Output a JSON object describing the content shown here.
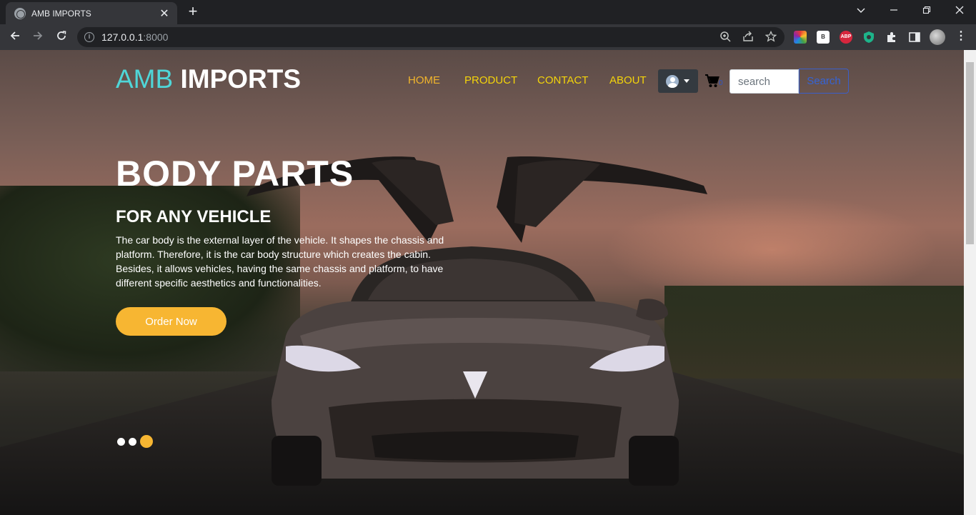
{
  "browser": {
    "tab_title": "AMB IMPORTS",
    "url_host": "127.0.0.1",
    "url_port": ":8000",
    "window_controls": [
      "chevron-down",
      "minimize",
      "maximize",
      "close"
    ]
  },
  "nav": {
    "brand_part1": "AMB",
    "brand_part2": "IMPORTS",
    "links": [
      {
        "label": "HOME",
        "active": true
      },
      {
        "label": "PRODUCT",
        "active": false
      },
      {
        "label": "CONTACT",
        "active": false
      },
      {
        "label": "ABOUT",
        "active": false
      }
    ],
    "search_placeholder": "search",
    "search_button": "Search"
  },
  "hero": {
    "title": "BODY PARTS",
    "subtitle": "FOR ANY VEHICLE",
    "text": "The car body is the external layer of the vehicle. It shapes the chassis and platform. Therefore, it is the car body structure which creates the cabin. Besides, it allows vehicles, having the same chassis and platform, to have different specific aesthetics and functionalities.",
    "cta": "Order Now",
    "carousel_count": 3,
    "carousel_active_index": 2
  },
  "colors": {
    "brand_accent": "#4fd6d8",
    "nav_link": "#f4d40a",
    "nav_active": "#f1b52c",
    "cta": "#f7b632"
  }
}
